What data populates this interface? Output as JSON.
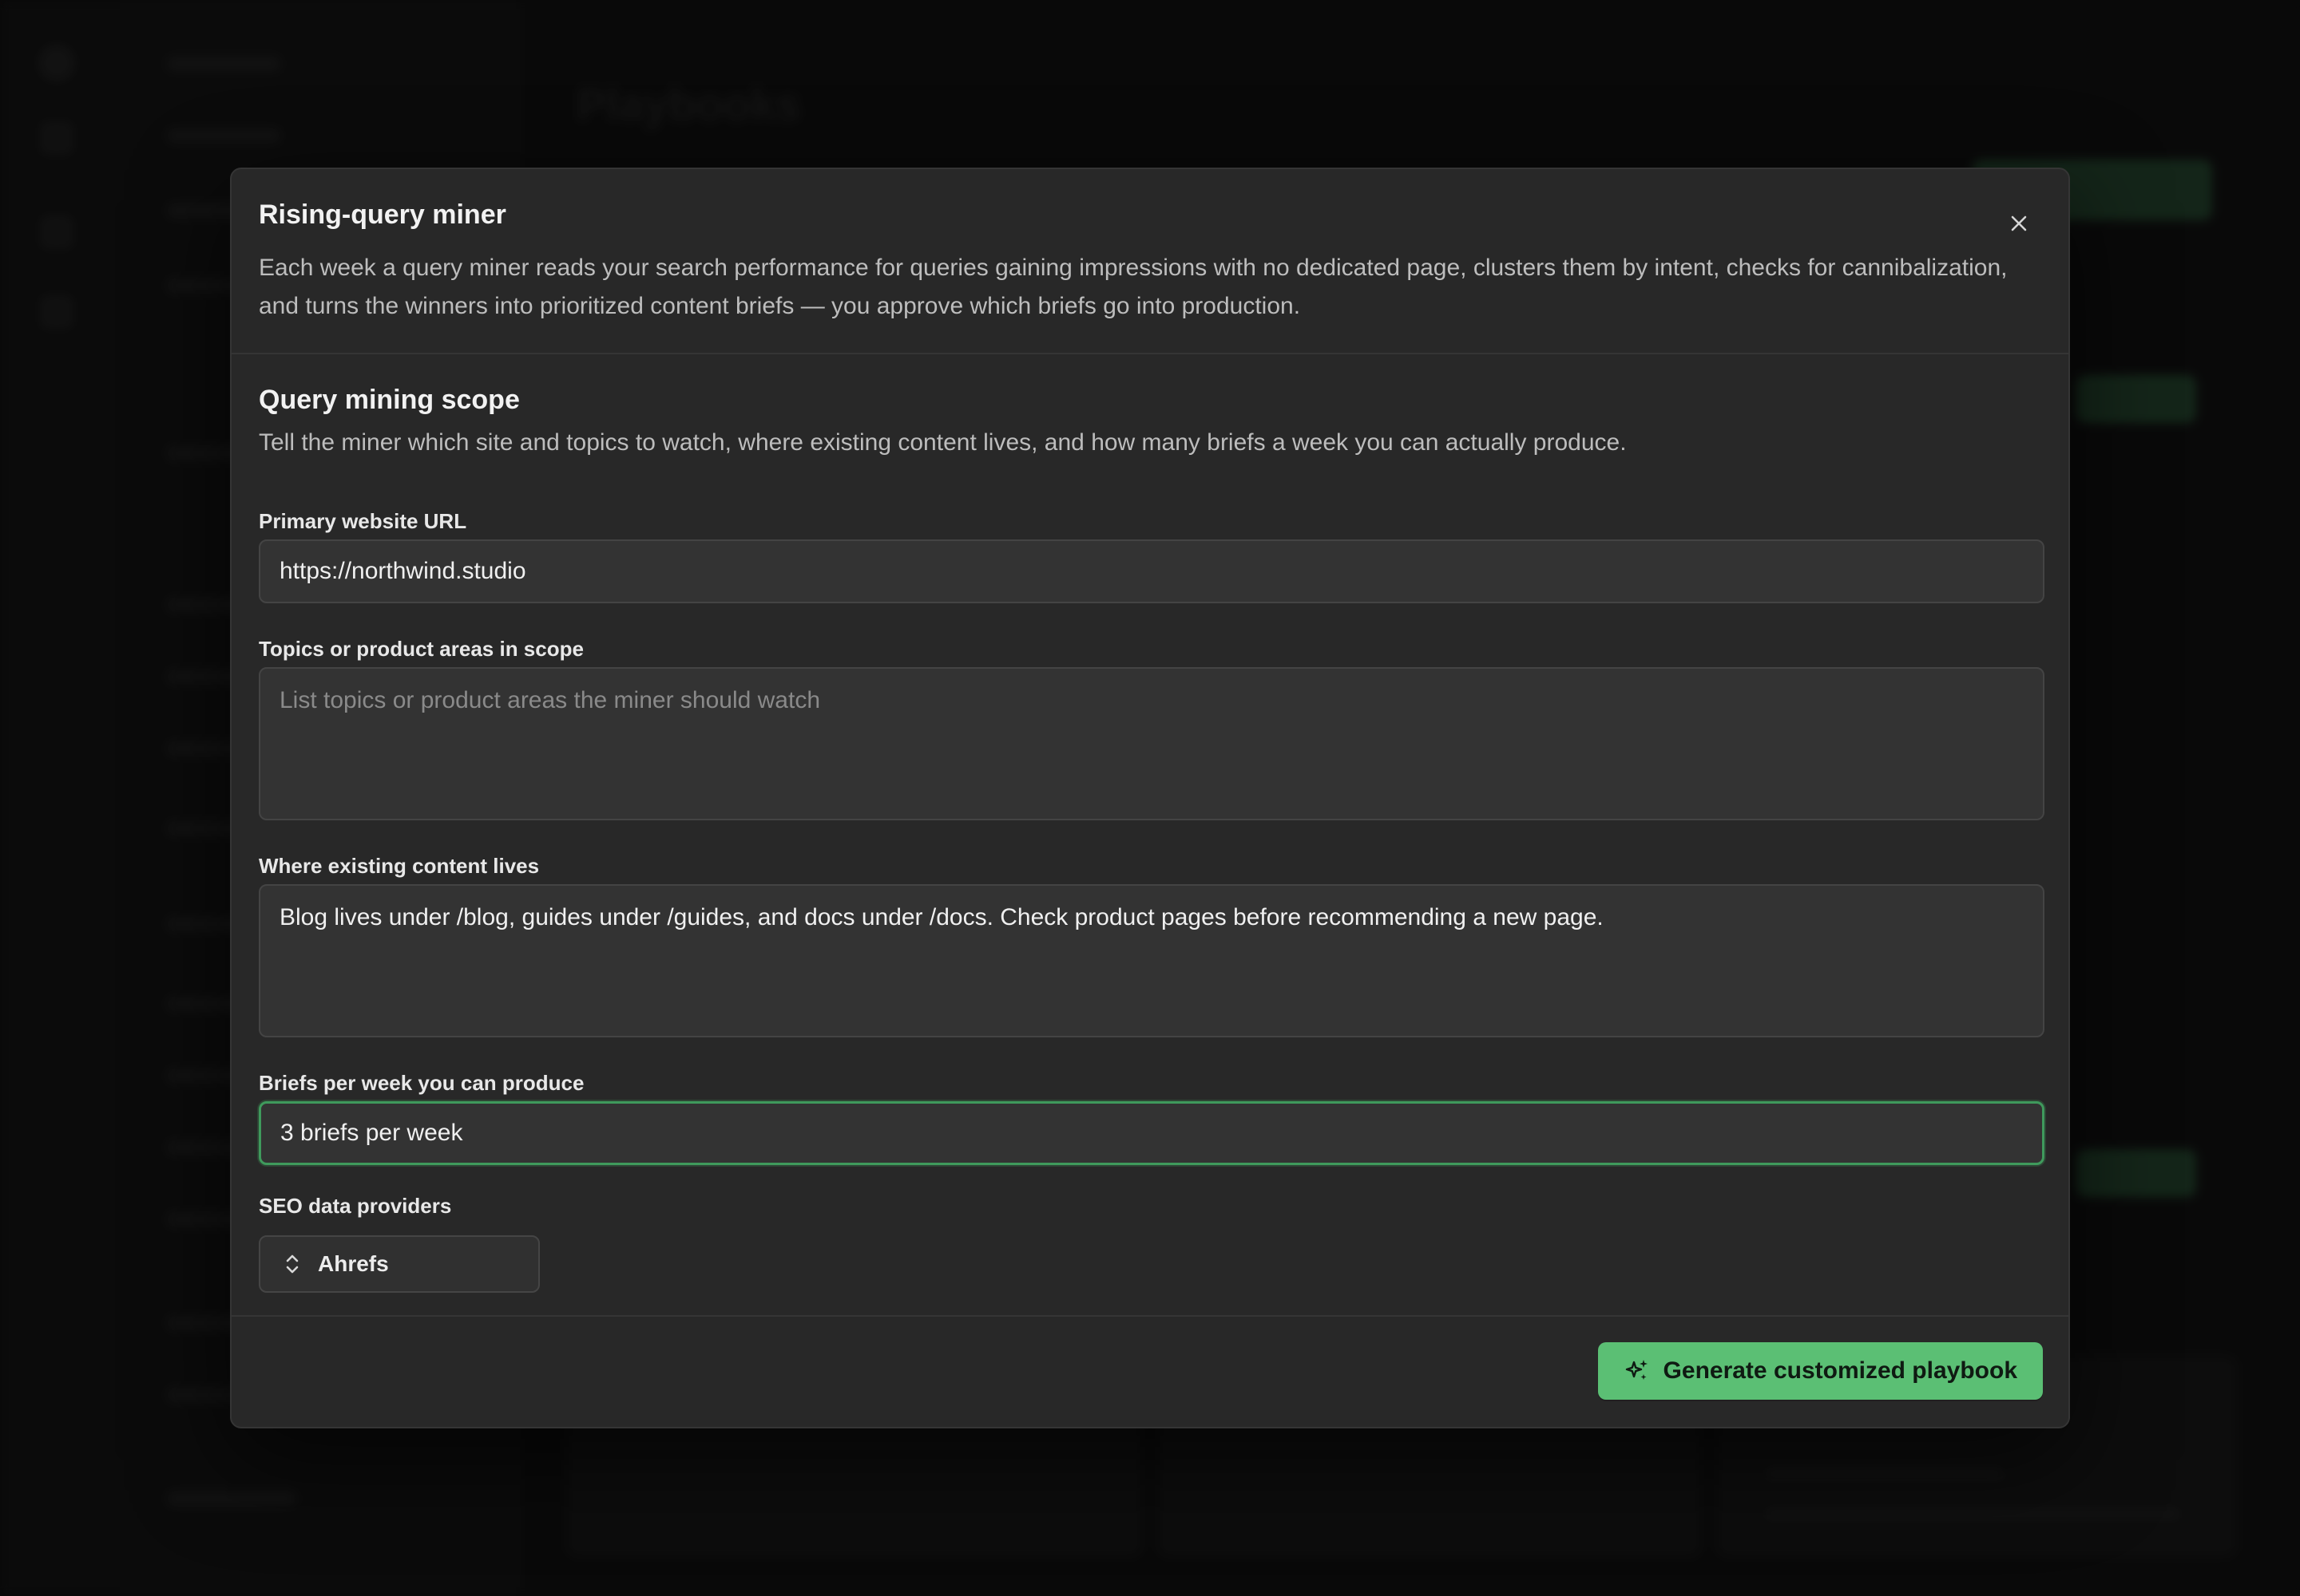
{
  "background": {
    "page_title": "Playbooks"
  },
  "modal": {
    "title": "Rising-query miner",
    "description": "Each week a query miner reads your search performance for queries gaining impressions with no dedicated page, clusters them by intent, checks for cannibalization, and turns the winners into prioritized content briefs — you approve which briefs go into production.",
    "close_icon": "close-icon",
    "section": {
      "title": "Query mining scope",
      "description": "Tell the miner which site and topics to watch, where existing content lives, and how many briefs a week you can actually produce."
    },
    "fields": {
      "website": {
        "label": "Primary website URL",
        "value": "https://northwind.studio"
      },
      "topics": {
        "label": "Topics or product areas in scope",
        "value": "",
        "placeholder": "List topics or product areas the miner should watch"
      },
      "content": {
        "label": "Where existing content lives",
        "value": "Blog lives under /blog, guides under /guides, and docs under /docs. Check product pages before recommending a new page."
      },
      "briefs": {
        "label": "Briefs per week you can produce",
        "value": "3 briefs per week"
      },
      "providers": {
        "label": "SEO data providers",
        "selected": "Ahrefs",
        "icon": "chevron-up-down-icon"
      }
    },
    "footer": {
      "generate_label": "Generate customized playbook",
      "generate_icon": "sparkles-icon"
    }
  },
  "colors": {
    "accent": "#5bbf74",
    "focus_border": "#3f9a5c",
    "modal_bg": "#282828",
    "input_bg": "#333333"
  }
}
